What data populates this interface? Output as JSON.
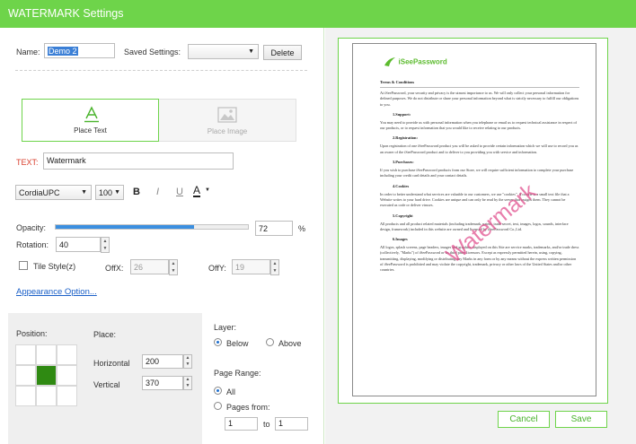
{
  "window": {
    "title": "WATERMARK Settings"
  },
  "top": {
    "name_label": "Name:",
    "name_value": "Demo 2",
    "saved_label": "Saved Settings:",
    "saved_value": "",
    "delete_label": "Delete"
  },
  "mode_tabs": [
    {
      "label": "Place Text",
      "icon": "text-a-icon",
      "selected": true
    },
    {
      "label": "Place Image",
      "icon": "image-icon",
      "selected": false
    }
  ],
  "text_section": {
    "label": "TEXT:",
    "value": "Watermark",
    "font": "CordiaUPC",
    "size": "100",
    "bold": "B",
    "italic": "I",
    "underline": "U",
    "color_letter": "A",
    "label_color": "#d9402f",
    "accent_color": "#6ed44a"
  },
  "opacity": {
    "label": "Opacity:",
    "value": "72",
    "unit": "%",
    "level": 0.72
  },
  "rotation": {
    "label": "Rotation:",
    "value": "40"
  },
  "tile": {
    "label": "Tile Style(z)",
    "checked": false,
    "offx_label": "OffX:",
    "offx_value": "26",
    "offy_label": "OffY:",
    "offy_value": "19"
  },
  "appearance_link": "Appearance Option...",
  "position": {
    "label": "Position:",
    "place_label": "Place:",
    "selected_cell": 4,
    "horizontal_label": "Horizontal",
    "horizontal_value": "200",
    "vertical_label": "Vertical",
    "vertical_value": "370"
  },
  "layer": {
    "label": "Layer:",
    "below": "Below",
    "above": "Above",
    "selected": "below"
  },
  "page_range": {
    "label": "Page Range:",
    "all": "All",
    "pages_from": "Pages from:",
    "from_value": "1",
    "to_label": "to",
    "to_value": "1",
    "selected": "all"
  },
  "preview": {
    "logo": "iSeePassword",
    "watermark_text": "Watermark",
    "watermark_color": "#e04a8a",
    "heading": "Terms & Conditions",
    "paragraphs": [
      {
        "type": "p",
        "text": "At iSeePassword, your security and privacy is the utmost importance to us. We will only collect your personal information for defined purposes. We do not distribute or share your personal information beyond what is strictly necessary to fulfill our obligations to you."
      },
      {
        "type": "h",
        "text": "1.Support:"
      },
      {
        "type": "p",
        "text": "You may need to provide us with personal information when you telephone or email us to request technical assistance in respect of our products, or to request information that you would like to receive relating to our products."
      },
      {
        "type": "h",
        "text": "2.Registration:"
      },
      {
        "type": "p",
        "text": "Upon registration of one iSeePassword product you will be asked to provide certain information which we will use to record you as an owner of the iSeePassword product and to deliver to you providing you with service and information."
      },
      {
        "type": "h",
        "text": "3.Purchases:"
      },
      {
        "type": "p",
        "text": "If you wish to purchase iSeePassword products from our Store, we will require sufficient information to complete your purchase including your credit card details and your contact details."
      },
      {
        "type": "h",
        "text": "4.Cookies"
      },
      {
        "type": "p",
        "text": "In order to better understand what services are valuable to our customers, we use \"cookies\". A cookie is a small text file that a Website writes to your hard drive. Cookies are unique and can only be read by the server that assigns them. They cannot be executed as code or deliver viruses."
      },
      {
        "type": "h",
        "text": "5.Copyright"
      },
      {
        "type": "p",
        "text": "All products and all product related materials (including trademark, patent, trade secret, text, images, logos, sounds, interface design, framework) included in this website are owned and licensed by iSeePassword Co.,Ltd."
      },
      {
        "type": "h",
        "text": "6.Images"
      },
      {
        "type": "p",
        "text": "All logos, splash screens, page headers, images and graphics displayed on this Site are service marks, trademarks, and/or trade dress (collectively, \"Marks\") of iSeePassword or its third party licensors. Except as expressly permitted herein, using, copying, transmitting, displaying, modifying or distributing any Marks in any form or by any means without the express written permission of iSeePassword is prohibited and may violate the copyright, trademark, privacy or other laws of the United States and/or other countries."
      }
    ]
  },
  "footer": {
    "cancel": "Cancel",
    "save": "Save"
  }
}
